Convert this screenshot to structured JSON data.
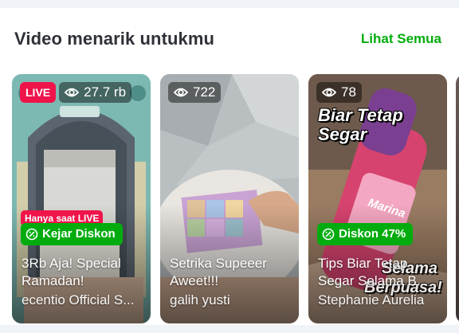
{
  "section": {
    "title": "Video menarik untukmu",
    "see_all": "Lihat Semua"
  },
  "cards": [
    {
      "live_label": "LIVE",
      "views": "27.7 rb",
      "live_badge": "Hanya saat LIVE",
      "promo": "Kejar Diskon",
      "title": "3Rb Aja! Special\nRamadan!",
      "shop": "ecentio Official S..."
    },
    {
      "views": "722",
      "title": "Setrika Supeeer\nAweet!!!",
      "shop": "galih yusti"
    },
    {
      "views": "78",
      "overlay_top": "Biar Tetap\nSegar",
      "overlay_bottom": "Selama\nBerpuasa!",
      "product": "Marina",
      "promo": "Diskon 47%",
      "title": "Tips Biar Tetap\nSegar Selama B...",
      "shop": "Stephanie Aurelia"
    }
  ],
  "colors": {
    "accent": "#03ac0e",
    "live": "#ef144a",
    "title": "#2e3137"
  },
  "icons": [
    "eye-icon",
    "discount-icon"
  ]
}
